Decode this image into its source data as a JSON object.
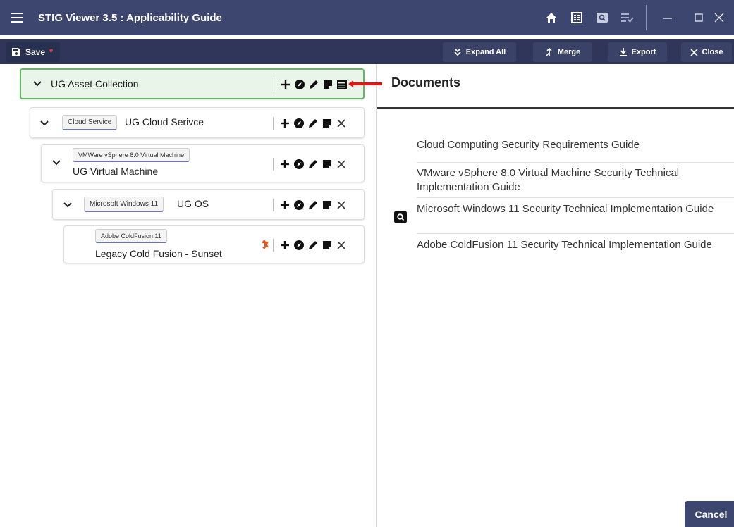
{
  "window": {
    "title": "STIG Viewer 3.5 : Applicability Guide",
    "menu_icon": "hamburger-icon",
    "tool_icons": [
      "home-icon",
      "checklist-icon",
      "search-screen-icon",
      "list-check-icon"
    ],
    "controls": [
      "minimize-icon",
      "maximize-icon",
      "close-icon"
    ]
  },
  "toolbar": {
    "save_label": "Save",
    "save_modified_mark": "*",
    "expand_all_label": "Expand All",
    "merge_label": "Merge",
    "export_label": "Export",
    "close_label": "Close"
  },
  "tree": {
    "root": {
      "name": "UG Asset Collection"
    },
    "nodes": [
      {
        "chip": "Cloud Service",
        "name": "UG Cloud Serivce"
      },
      {
        "chip": "VMWare vSphere 8.0 Virtual Machine",
        "name": "UG Virtual Machine"
      },
      {
        "chip": "Microsoft Windows 11",
        "name": "UG OS"
      },
      {
        "chip": "Adobe ColdFusion 11",
        "name": "Legacy Cold Fusion - Sunset"
      }
    ]
  },
  "documents": {
    "title": "Documents",
    "items": [
      {
        "label": "Cloud Computing Security Requirements Guide"
      },
      {
        "label": "VMware vSphere 8.0 Virtual Machine Security Technical Implementation Guide"
      },
      {
        "label": "Microsoft Windows 11 Security Technical Implementation Guide",
        "icon": "search-screen-icon"
      },
      {
        "label": "Adobe ColdFusion 11 Security Technical Implementation Guide"
      }
    ]
  },
  "footer": {
    "cancel_label": "Cancel"
  },
  "colors": {
    "titlebar": "#3c466e",
    "toolbar": "#2f3659",
    "root_highlight": "#e9f5e9",
    "root_border": "#5fb95f",
    "warning_icon": "#e8541c",
    "annotation_arrow": "#ee1111"
  }
}
